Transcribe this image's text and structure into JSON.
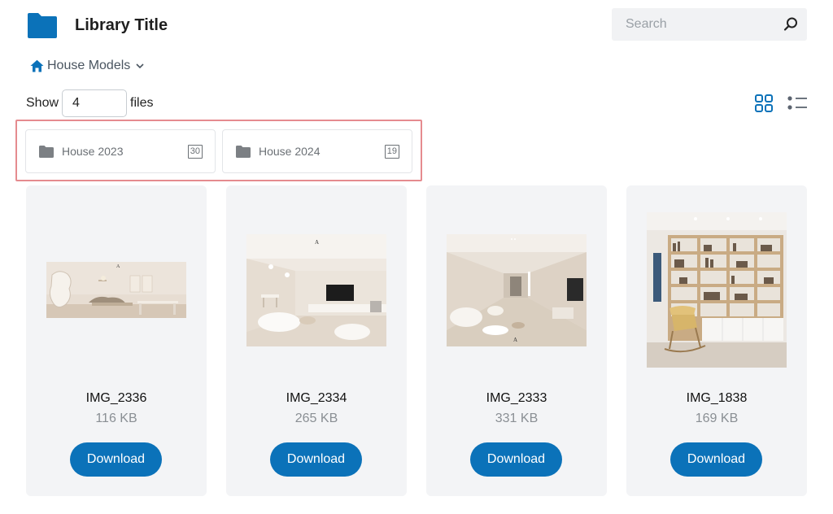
{
  "header": {
    "title": "Library Title",
    "search_placeholder": "Search"
  },
  "breadcrumb": {
    "label": "House Models"
  },
  "show": {
    "prefix": "Show",
    "value": "4",
    "suffix": "files"
  },
  "folders": [
    {
      "name": "House 2023",
      "count": "30"
    },
    {
      "name": "House 2024",
      "count": "19"
    }
  ],
  "files": [
    {
      "name": "IMG_2336",
      "size": "116 KB",
      "download_label": "Download"
    },
    {
      "name": "IMG_2334",
      "size": "265 KB",
      "download_label": "Download"
    },
    {
      "name": "IMG_2333",
      "size": "331 KB",
      "download_label": "Download"
    },
    {
      "name": "IMG_1838",
      "size": "169 KB",
      "download_label": "Download"
    }
  ],
  "colors": {
    "accent": "#0b72b9",
    "highlight": "#e58b8f",
    "card_bg": "#f3f4f6"
  },
  "icons": {
    "logo": "folder-icon",
    "search": "search-icon",
    "home": "home-icon",
    "dropdown": "chevron-down-icon",
    "grid_view": "grid-view-icon",
    "list_view": "list-view-icon",
    "folder": "folder-icon"
  }
}
